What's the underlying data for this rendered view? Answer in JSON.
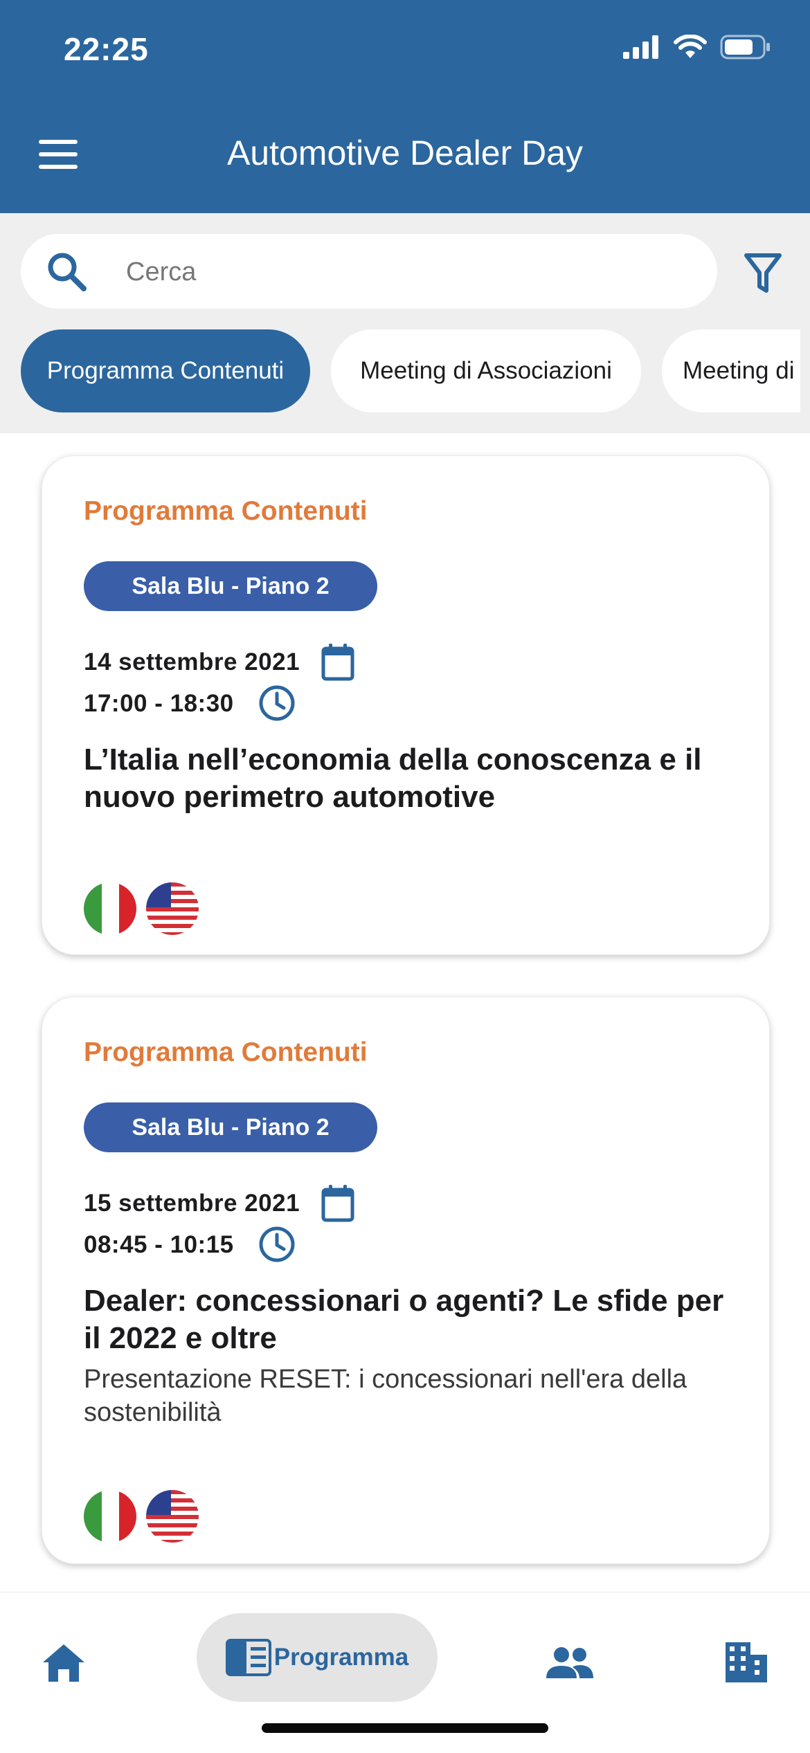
{
  "status_bar": {
    "time": "22:25"
  },
  "header": {
    "title": "Automotive Dealer Day"
  },
  "search": {
    "placeholder": "Cerca"
  },
  "filters": {
    "chips": [
      {
        "label": "Programma Contenuti",
        "active": true
      },
      {
        "label": "Meeting di Associazioni",
        "active": false
      },
      {
        "label": "Meeting di",
        "active": false
      }
    ]
  },
  "events": [
    {
      "category": "Programma Contenuti",
      "room": "Sala Blu - Piano 2",
      "date": "14 settembre 2021",
      "time": "17:00 - 18:30",
      "title": "L’Italia nell’economia della conoscenza e il nuovo perimetro automotive",
      "subtitle": "",
      "languages": [
        "it",
        "en"
      ]
    },
    {
      "category": "Programma Contenuti",
      "room": "Sala Blu - Piano 2",
      "date": "15 settembre 2021",
      "time": "08:45 - 10:15",
      "title": "Dealer: concessionari o agenti? Le sfide per il 2022 e oltre",
      "subtitle": "Presentazione RESET: i concessionari nell'era della sostenibilità",
      "languages": [
        "it",
        "en"
      ]
    }
  ],
  "tabbar": {
    "programma_label": "Programma"
  },
  "colors": {
    "primary": "#2b669e",
    "accent": "#e07b3a",
    "room_badge": "#3a5fa8"
  },
  "icons": [
    "wifi-icon",
    "battery-icon",
    "signal-icon",
    "menu-icon",
    "search-icon",
    "filter-icon",
    "calendar-icon",
    "clock-icon",
    "home-icon",
    "schedule-icon",
    "people-icon",
    "building-icon"
  ]
}
